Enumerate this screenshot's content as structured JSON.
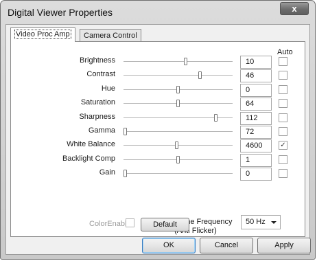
{
  "window": {
    "title": "Digital Viewer Properties",
    "close_label": "x"
  },
  "tabs": [
    {
      "label": "Video Proc Amp",
      "active": true
    },
    {
      "label": "Camera Control",
      "active": false
    }
  ],
  "auto_header": "Auto",
  "properties": [
    {
      "label": "Brightness",
      "value": "10",
      "level": 0.57,
      "auto": false
    },
    {
      "label": "Contrast",
      "value": "46",
      "level": 0.71,
      "auto": false
    },
    {
      "label": "Hue",
      "value": "0",
      "level": 0.5,
      "auto": false
    },
    {
      "label": "Saturation",
      "value": "64",
      "level": 0.5,
      "auto": false
    },
    {
      "label": "Sharpness",
      "value": "112",
      "level": 0.86,
      "auto": false
    },
    {
      "label": "Gamma",
      "value": "72",
      "level": 0.0,
      "auto": false
    },
    {
      "label": "White Balance",
      "value": "4600",
      "level": 0.49,
      "auto": true
    },
    {
      "label": "Backlight Comp",
      "value": "1",
      "level": 0.5,
      "auto": false
    },
    {
      "label": "Gain",
      "value": "0",
      "level": 0.0,
      "auto": false
    }
  ],
  "color_enable": {
    "label": "ColorEnable",
    "checked": false
  },
  "powerline": {
    "label_line1": "PowerLine Frequency",
    "label_line2": "(Anti Flicker)",
    "selected": "50 Hz"
  },
  "buttons": {
    "default": "Default",
    "ok": "OK",
    "cancel": "Cancel",
    "apply": "Apply"
  },
  "check_glyph": "✓"
}
